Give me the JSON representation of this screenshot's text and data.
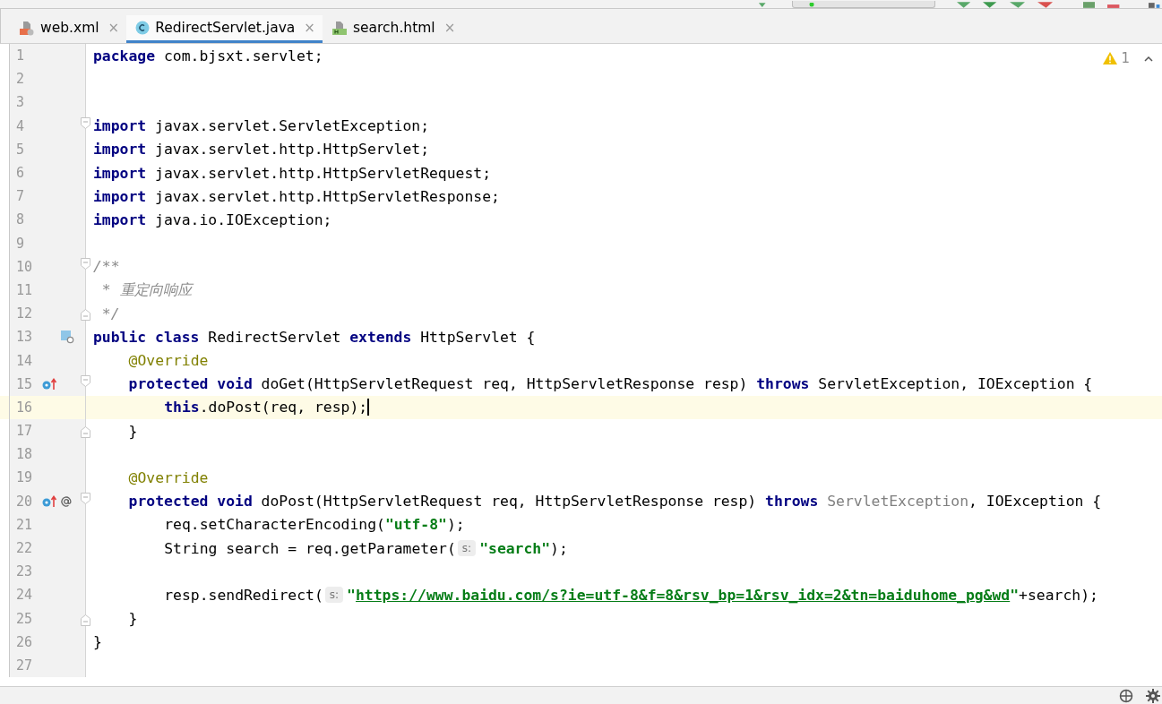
{
  "tabs": [
    {
      "label": "web.xml",
      "kind": "xml",
      "selected": false,
      "close": "×"
    },
    {
      "label": "RedirectServlet.java",
      "kind": "java",
      "selected": true,
      "close": "×"
    },
    {
      "label": "search.html",
      "kind": "html",
      "selected": false,
      "close": "×"
    }
  ],
  "inspections": {
    "warnings": "1"
  },
  "lines": [
    {
      "number": "1",
      "current": false,
      "tokens": [
        {
          "kind": "kw",
          "s": "package"
        },
        {
          "kind": "plain",
          "s": " com.bjsxt.servlet;"
        }
      ]
    },
    {
      "number": "2",
      "current": false
    },
    {
      "number": "3",
      "current": false
    },
    {
      "number": "4",
      "current": false,
      "fold": {
        "kind": "start"
      },
      "tokens": [
        {
          "kind": "kw",
          "s": "import"
        },
        {
          "kind": "plain",
          "s": " javax.servlet.ServletException;"
        }
      ]
    },
    {
      "number": "5",
      "current": false,
      "tokens": [
        {
          "kind": "kw",
          "s": "import"
        },
        {
          "kind": "plain",
          "s": " javax.servlet.http.HttpServlet;"
        }
      ]
    },
    {
      "number": "6",
      "current": false,
      "tokens": [
        {
          "kind": "kw",
          "s": "import"
        },
        {
          "kind": "plain",
          "s": " javax.servlet.http.HttpServletRequest;"
        }
      ]
    },
    {
      "number": "7",
      "current": false,
      "tokens": [
        {
          "kind": "kw",
          "s": "import"
        },
        {
          "kind": "plain",
          "s": " javax.servlet.http.HttpServletResponse;"
        }
      ]
    },
    {
      "number": "8",
      "current": false,
      "tokens": [
        {
          "kind": "kw",
          "s": "import"
        },
        {
          "kind": "plain",
          "s": " java.io.IOException;"
        }
      ]
    },
    {
      "number": "9",
      "current": false
    },
    {
      "number": "10",
      "current": false,
      "fold": {
        "kind": "start"
      },
      "tokens": [
        {
          "kind": "comment",
          "s": "/**"
        }
      ]
    },
    {
      "number": "11",
      "current": false,
      "tokens": [
        {
          "kind": "comment",
          "s": " * 重定向响应"
        }
      ]
    },
    {
      "number": "12",
      "current": false,
      "fold": {
        "kind": "end"
      },
      "tokens": [
        {
          "kind": "comment",
          "s": " */"
        }
      ]
    },
    {
      "number": "13",
      "current": false,
      "marks": [
        {
          "kind": "class"
        }
      ],
      "tokens": [
        {
          "kind": "kw",
          "s": "public class"
        },
        {
          "kind": "plain",
          "s": " RedirectServlet "
        },
        {
          "kind": "kw",
          "s": "extends"
        },
        {
          "kind": "plain",
          "s": " HttpServlet {"
        }
      ],
      "children": [
        {
          "number": "14",
          "current": false,
          "tokens": [
            {
              "kind": "ann",
              "s": "@Override"
            }
          ]
        },
        {
          "number": "15",
          "current": false,
          "marks": [
            {
              "kind": "override"
            }
          ],
          "fold": {
            "kind": "start"
          },
          "tokens": [
            {
              "kind": "kw",
              "s": "protected void"
            },
            {
              "kind": "plain",
              "s": " doGet(HttpServletRequest req, HttpServletResponse resp) "
            },
            {
              "kind": "kw",
              "s": "throws"
            },
            {
              "kind": "plain",
              "s": " ServletException, IOException {"
            }
          ],
          "children": [
            {
              "number": "16",
              "current": true,
              "tokens": [
                {
                  "kind": "kw",
                  "s": "this"
                },
                {
                  "kind": "plain",
                  "s": ".doPost(req, resp);"
                }
              ]
            }
          ]
        },
        {
          "number": "17",
          "current": false,
          "fold": {
            "kind": "end"
          },
          "tokens": [
            {
              "kind": "plain",
              "s": "}"
            }
          ]
        },
        {
          "number": "18",
          "current": false
        },
        {
          "number": "19",
          "current": false,
          "tokens": [
            {
              "kind": "ann",
              "s": "@Override"
            }
          ]
        },
        {
          "number": "20",
          "current": false,
          "marks": [
            {
              "kind": "override"
            },
            {
              "kind": "at"
            }
          ],
          "fold": {
            "kind": "start"
          },
          "tokens": [
            {
              "kind": "kw",
              "s": "protected void"
            },
            {
              "kind": "plain",
              "s": " doPost(HttpServletRequest req, HttpServletResponse resp) "
            },
            {
              "kind": "kw",
              "s": "throws"
            },
            {
              "kind": "grey",
              "s": " ServletException"
            },
            {
              "kind": "plain",
              "s": ", IOException {"
            }
          ],
          "children": [
            {
              "number": "21",
              "current": false,
              "tokens": [
                {
                  "kind": "plain",
                  "s": "req.setCharacterEncoding("
                },
                {
                  "kind": "str",
                  "s": "\"utf-8\""
                },
                {
                  "kind": "plain",
                  "s": ");"
                }
              ]
            },
            {
              "number": "22",
              "current": false,
              "tokens": [
                {
                  "kind": "plain",
                  "s": "String search = req.getParameter("
                },
                {
                  "kind": "hint",
                  "s": "s:"
                },
                {
                  "kind": "str",
                  "s": "\"search\""
                },
                {
                  "kind": "plain",
                  "s": ");"
                }
              ]
            },
            {
              "number": "23",
              "current": false
            },
            {
              "number": "24",
              "current": false,
              "tokens": [
                {
                  "kind": "plain",
                  "s": "resp.sendRedirect("
                },
                {
                  "kind": "hint",
                  "s": "s:"
                },
                {
                  "kind": "str",
                  "s": "\""
                },
                {
                  "kind": "url",
                  "s": "https://www.baidu.com/s?ie=utf-8&f=8&rsv_bp=1&rsv_idx=2&tn=baiduhome_pg&wd"
                },
                {
                  "kind": "str",
                  "s": "\""
                },
                {
                  "kind": "plain",
                  "s": "+search);"
                }
              ]
            }
          ]
        },
        {
          "number": "25",
          "current": false,
          "fold": {
            "kind": "end"
          },
          "tokens": [
            {
              "kind": "plain",
              "s": "}"
            }
          ]
        }
      ]
    },
    {
      "number": "26",
      "current": false,
      "tokens": [
        {
          "kind": "plain",
          "s": "}"
        }
      ]
    },
    {
      "number": "27",
      "current": false
    }
  ]
}
